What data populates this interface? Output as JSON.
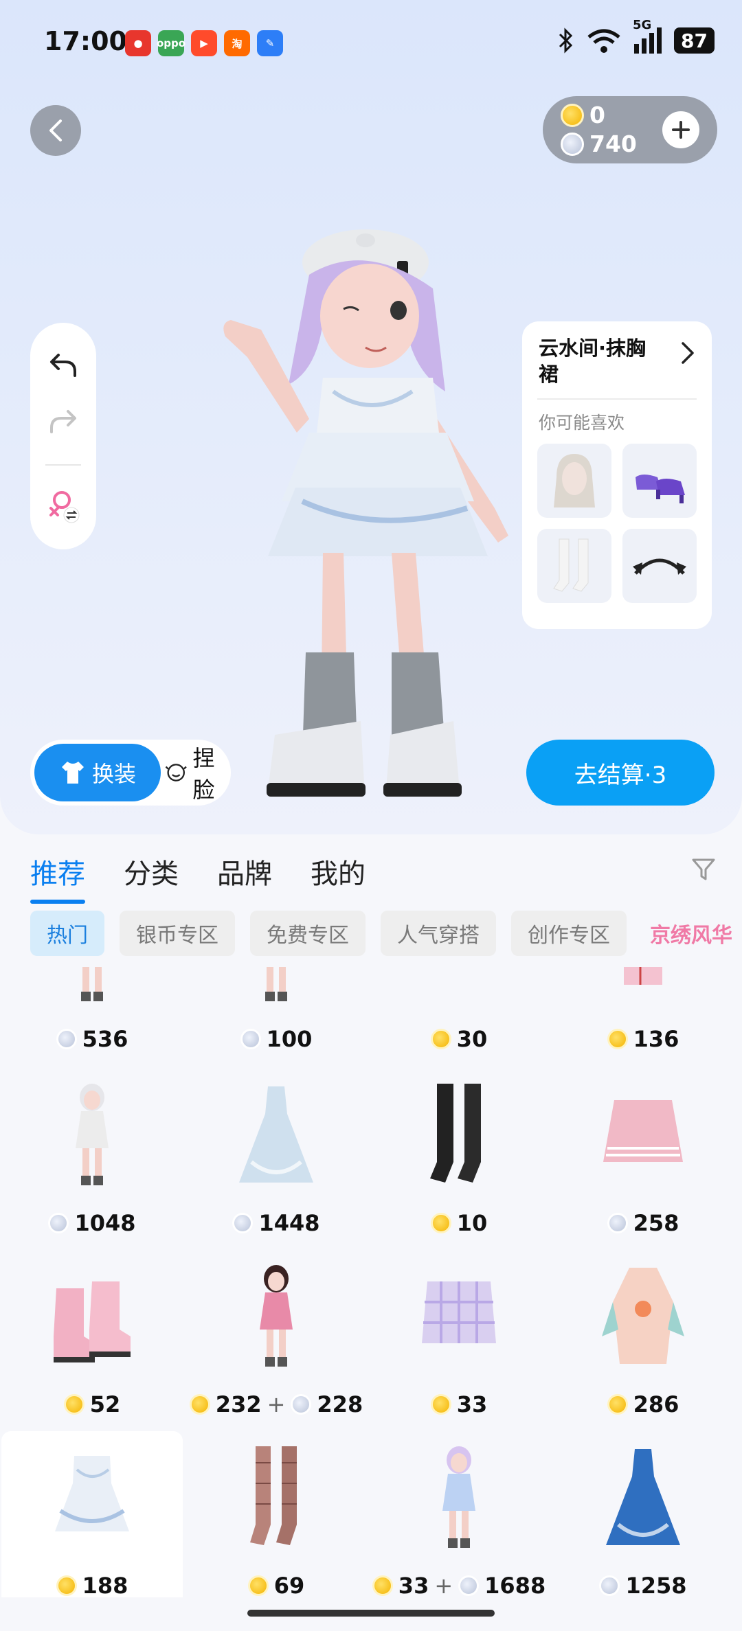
{
  "status_bar": {
    "time": "17:00",
    "battery": "87",
    "network": "5G",
    "app_icons": [
      {
        "name": "music-app-icon",
        "color": "#e8362d",
        "glyph": "●"
      },
      {
        "name": "oppo-app-icon",
        "color": "#3aa655",
        "glyph": "oppo"
      },
      {
        "name": "video-app-icon",
        "color": "#ff4b2b",
        "glyph": "▶"
      },
      {
        "name": "taobao-app-icon",
        "color": "#ff6a00",
        "glyph": "淘"
      },
      {
        "name": "feather-app-icon",
        "color": "#2d7ef7",
        "glyph": "✎"
      }
    ]
  },
  "currency": {
    "gold": "0",
    "silver": "740"
  },
  "recommend_panel": {
    "title": "云水间·抹胸裙",
    "subtitle": "你可能喜欢",
    "items": [
      "hair",
      "shoes",
      "socks",
      "headband"
    ]
  },
  "mode_switch": {
    "dress_label": "换装",
    "face_label": "捏脸"
  },
  "checkout": {
    "label": "去结算·3"
  },
  "tabs": [
    "推荐",
    "分类",
    "品牌",
    "我的"
  ],
  "chips": [
    "热门",
    "银币专区",
    "免费专区",
    "人气穿搭",
    "创作专区",
    "京绣风华"
  ],
  "items": [
    {
      "kind": "figure-lilac",
      "prices": [
        {
          "type": "silver",
          "value": "536"
        }
      ]
    },
    {
      "kind": "figure-pink",
      "prices": [
        {
          "type": "silver",
          "value": "100"
        }
      ]
    },
    {
      "kind": "bat-wings",
      "prices": [
        {
          "type": "gold",
          "value": "30"
        }
      ]
    },
    {
      "kind": "pink-jacket",
      "prices": [
        {
          "type": "gold",
          "value": "136"
        }
      ]
    },
    {
      "kind": "figure-beret",
      "prices": [
        {
          "type": "silver",
          "value": "1048"
        }
      ]
    },
    {
      "kind": "blue-gown",
      "prices": [
        {
          "type": "silver",
          "value": "1448"
        }
      ]
    },
    {
      "kind": "black-stockings",
      "prices": [
        {
          "type": "gold",
          "value": "10"
        }
      ]
    },
    {
      "kind": "pink-skirt",
      "prices": [
        {
          "type": "silver",
          "value": "258"
        }
      ]
    },
    {
      "kind": "pink-boots",
      "prices": [
        {
          "type": "gold",
          "value": "52"
        }
      ]
    },
    {
      "kind": "figure-red",
      "prices": [
        {
          "type": "gold",
          "value": "232"
        },
        {
          "type": "silver",
          "value": "228"
        }
      ]
    },
    {
      "kind": "plaid-skirt",
      "prices": [
        {
          "type": "gold",
          "value": "33"
        }
      ]
    },
    {
      "kind": "floral-dress",
      "prices": [
        {
          "type": "gold",
          "value": "286"
        }
      ]
    },
    {
      "kind": "white-dress",
      "prices": [
        {
          "type": "gold",
          "value": "188"
        }
      ],
      "selected": true
    },
    {
      "kind": "fishnet-stockings",
      "prices": [
        {
          "type": "gold",
          "value": "69"
        }
      ]
    },
    {
      "kind": "figure-blue",
      "prices": [
        {
          "type": "gold",
          "value": "33"
        },
        {
          "type": "silver",
          "value": "1688"
        }
      ]
    },
    {
      "kind": "blue-gown-2",
      "prices": [
        {
          "type": "silver",
          "value": "1258"
        }
      ]
    }
  ]
}
